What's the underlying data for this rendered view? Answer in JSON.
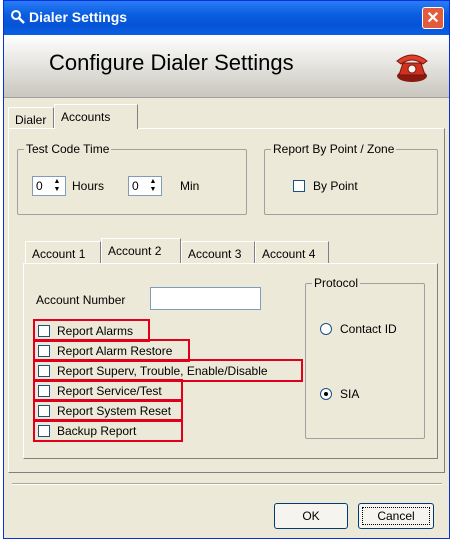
{
  "window": {
    "title": "Dialer Settings",
    "close_glyph": "✕"
  },
  "header": {
    "title": "Configure Dialer Settings",
    "icon": "telephone-icon"
  },
  "main_tabs": [
    {
      "label": "Dialer"
    },
    {
      "label": "Accounts"
    }
  ],
  "test_code_time": {
    "label": "Test Code Time",
    "hours_value": "0",
    "hours_label": "Hours",
    "min_value": "0",
    "min_label": "Min"
  },
  "report_by_point": {
    "label": "Report By Point / Zone",
    "checkbox_label": "By Point",
    "checked": false
  },
  "account_tabs": [
    {
      "label": "Account 1"
    },
    {
      "label": "Account 2"
    },
    {
      "label": "Account 3"
    },
    {
      "label": "Account 4"
    }
  ],
  "account": {
    "number_label": "Account Number",
    "number_value": "",
    "options": [
      {
        "label": "Report Alarms",
        "checked": false
      },
      {
        "label": "Report Alarm Restore",
        "checked": false
      },
      {
        "label": "Report Superv, Trouble, Enable/Disable",
        "checked": false
      },
      {
        "label": "Report Service/Test",
        "checked": false
      },
      {
        "label": "Report System Reset",
        "checked": false
      },
      {
        "label": "Backup Report",
        "checked": false
      }
    ]
  },
  "protocol": {
    "label": "Protocol",
    "options": [
      {
        "label": "Contact ID",
        "selected": false
      },
      {
        "label": "SIA",
        "selected": true
      }
    ]
  },
  "buttons": {
    "ok": "OK",
    "cancel": "Cancel"
  },
  "colors": {
    "titlebar": "#0a5ee0",
    "highlight": "#e0001b",
    "dialog_bg": "#ece9d8"
  }
}
